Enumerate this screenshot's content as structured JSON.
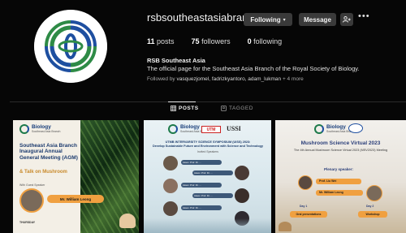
{
  "profile": {
    "username": "rsbsoutheastasiabranch",
    "buttons": {
      "following": "Following",
      "message": "Message"
    },
    "stats": {
      "posts_count": "11",
      "posts_label": "posts",
      "followers_count": "75",
      "followers_label": "followers",
      "following_count": "0",
      "following_label": "following"
    },
    "bio_name": "RSB Southeast Asia",
    "bio_text": "The official page for the Southeast Asia Branch of the Royal Society of Biology.",
    "followed_by_prefix": "Followed by",
    "followed_by_names": "vasquezjomel, fadrizkyantoro, adam_lukman",
    "followed_by_more": "+ 4 more"
  },
  "tabs": [
    {
      "label": "POSTS"
    },
    {
      "label": "TAGGED"
    }
  ],
  "posts": [
    {
      "logo_title": "Biology",
      "logo_sub": "Southeast Asia Branch",
      "title": "Southeast Asia Branch Inaugural Annual General Meeting (AGM)",
      "subtitle": "& Talk on Mushroom",
      "guest_label": "With Guest Speaker",
      "speaker": "Mr. William Leong",
      "footer": "THURSDAY"
    },
    {
      "logo_title": "Biology",
      "logo_sub": "Southeast Asia Branch",
      "partner1": "UTM",
      "partner2": "USSI",
      "title": "UTMB INTERVARSITY SCIENCE SYMPOSIUM (UISS) 2023:",
      "subtitle": "Develop Sustainable Future and Environment with Science and Technology",
      "invited": "Invited Speakers",
      "speakers": [
        "Assoc. Prof. Dr. ...",
        "Assoc. Prof. Dr. ...",
        "Assoc. Prof. Dr. ...",
        "Assoc. Prof. Dr. ...",
        "Assoc. Prof. Dr. ..."
      ]
    },
    {
      "logo_title": "Biology",
      "logo_sub": "Southeast Asia Branch",
      "title": "Mushroom Science Virtual 2023",
      "subtitle": "The 4th Annual Mushroom Science Virtual 2023 (MSV2023) Meeting",
      "plenary": "Plenary speaker:",
      "speaker1": "Prof. Liu Wei",
      "speaker2": "Mr. William Leong",
      "day1": "Day 1",
      "day1_label": "Oral presentations",
      "day2": "Day 2",
      "day2_label": "Workshop"
    }
  ],
  "colors": {
    "bg": "#060606",
    "button": "#3a3a3a",
    "brand_green": "#1d7a4a",
    "brand_blue": "#1e4fa0",
    "accent_orange": "#f0a040"
  }
}
